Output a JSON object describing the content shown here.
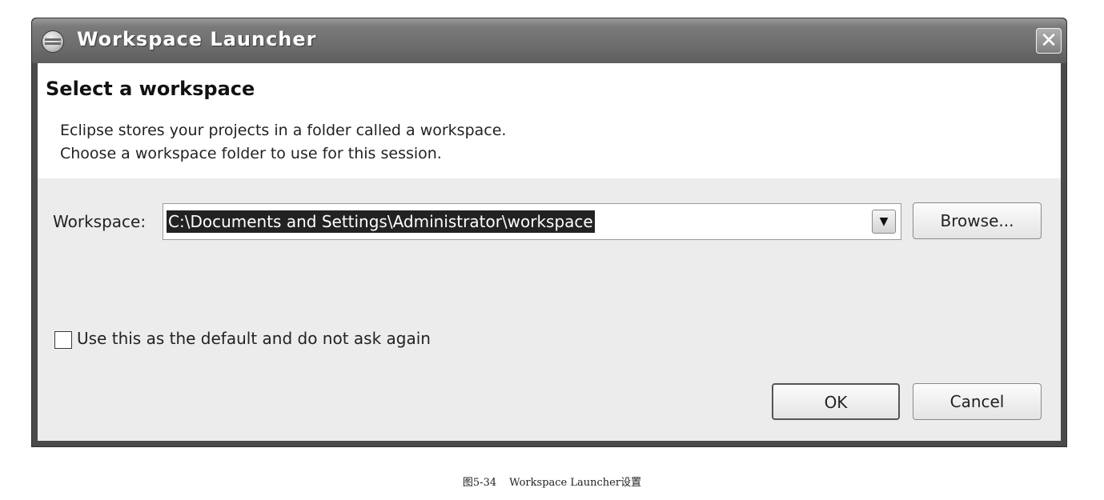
{
  "window": {
    "title": "Workspace Launcher",
    "close_glyph": "✕"
  },
  "header": {
    "title": "Select a workspace",
    "description_line1": "Eclipse stores your projects in a folder called a workspace.",
    "description_line2": "Choose a workspace folder to use for this session."
  },
  "workspace": {
    "label": "Workspace:",
    "value": "C:\\Documents and Settings\\Administrator\\workspace",
    "dropdown_glyph": "▼"
  },
  "buttons": {
    "browse_label": "Browse...",
    "ok_label": "OK",
    "cancel_label": "Cancel"
  },
  "default_checkbox": {
    "label": "Use this as the default and do not ask again",
    "checked": false
  },
  "caption": {
    "figure_number": "图5-34",
    "text": "Workspace Launcher设置"
  },
  "icons": {
    "app": "eclipse-icon",
    "close": "close-icon",
    "dropdown": "chevron-down-icon"
  },
  "colors": {
    "title_bar": "#6e6e6e",
    "selection": "#222222",
    "body_bg": "#ececec"
  }
}
